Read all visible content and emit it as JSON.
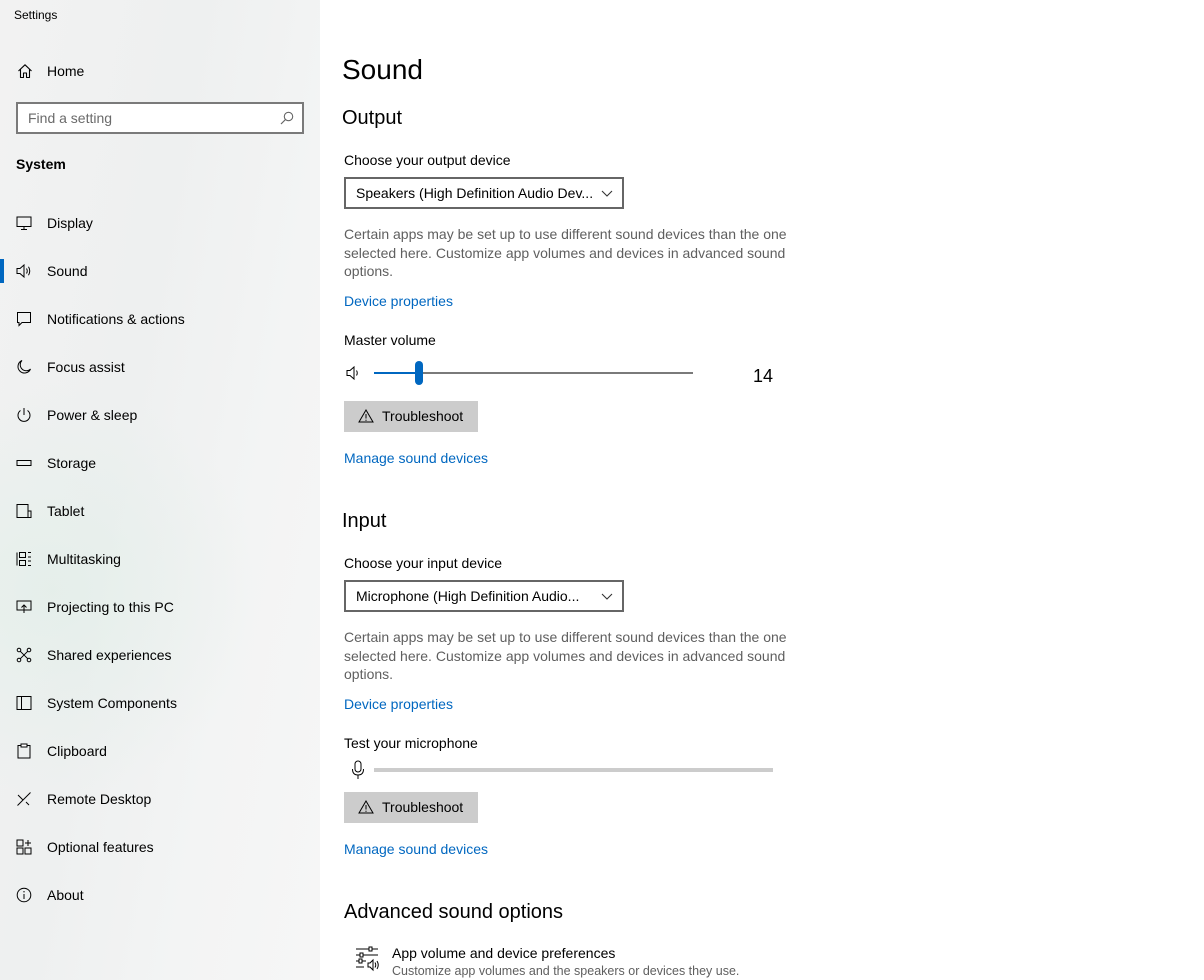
{
  "app": {
    "title": "Settings"
  },
  "sidebar": {
    "home_label": "Home",
    "search_placeholder": "Find a setting",
    "section": "System",
    "selected": "Sound",
    "items": [
      {
        "label": "Display",
        "icon": "monitor-icon"
      },
      {
        "label": "Sound",
        "icon": "speaker-icon"
      },
      {
        "label": "Notifications & actions",
        "icon": "message-icon"
      },
      {
        "label": "Focus assist",
        "icon": "moon-icon"
      },
      {
        "label": "Power & sleep",
        "icon": "power-icon"
      },
      {
        "label": "Storage",
        "icon": "storage-icon"
      },
      {
        "label": "Tablet",
        "icon": "tablet-icon"
      },
      {
        "label": "Multitasking",
        "icon": "multitasking-icon"
      },
      {
        "label": "Projecting to this PC",
        "icon": "projecting-icon"
      },
      {
        "label": "Shared experiences",
        "icon": "shared-icon"
      },
      {
        "label": "System Components",
        "icon": "components-icon"
      },
      {
        "label": "Clipboard",
        "icon": "clipboard-icon"
      },
      {
        "label": "Remote Desktop",
        "icon": "remote-desktop-icon"
      },
      {
        "label": "Optional features",
        "icon": "optional-features-icon"
      },
      {
        "label": "About",
        "icon": "info-icon"
      }
    ]
  },
  "main": {
    "title": "Sound",
    "output": {
      "heading": "Output",
      "device_label": "Choose your output device",
      "device_value": "Speakers (High Definition Audio Dev...",
      "description": "Certain apps may be set up to use different sound devices than the one selected here. Customize app volumes and devices in advanced sound options.",
      "device_properties": "Device properties",
      "volume_label": "Master volume",
      "volume": 14,
      "volume_display": "14",
      "troubleshoot": "Troubleshoot",
      "manage": "Manage sound devices"
    },
    "input": {
      "heading": "Input",
      "device_label": "Choose your input device",
      "device_value": "Microphone (High Definition Audio...",
      "description": "Certain apps may be set up to use different sound devices than the one selected here. Customize app volumes and devices in advanced sound options.",
      "device_properties": "Device properties",
      "test_label": "Test your microphone",
      "troubleshoot": "Troubleshoot",
      "manage": "Manage sound devices"
    },
    "advanced": {
      "heading": "Advanced sound options",
      "item_title": "App volume and device preferences",
      "item_subtitle": "Customize app volumes and the speakers or devices they use."
    }
  },
  "colors": {
    "accent": "#0067c0",
    "button": "#cccccc",
    "secondary_text": "#5f5f5f"
  }
}
